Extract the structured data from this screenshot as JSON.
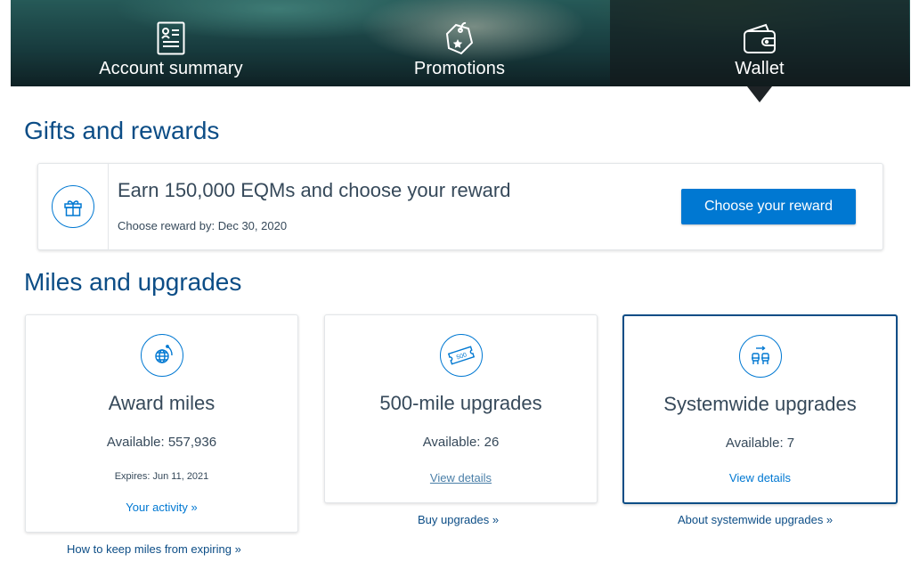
{
  "nav": {
    "tabs": [
      {
        "label": "Account summary",
        "icon": "account-summary-icon"
      },
      {
        "label": "Promotions",
        "icon": "promotion-tag-icon"
      },
      {
        "label": "Wallet",
        "icon": "wallet-icon",
        "active": true
      }
    ]
  },
  "gifts": {
    "title": "Gifts and rewards",
    "headline": "Earn 150,000 EQMs and choose your reward",
    "deadline": "Choose reward by: Dec 30, 2020",
    "button_label": "Choose your reward",
    "icon": "gift-icon"
  },
  "miles": {
    "title": "Miles and upgrades",
    "tiles": [
      {
        "icon": "globe-miles-icon",
        "title": "Award miles",
        "available": "Available: 557,936",
        "expires": "Expires: Jun 11, 2021",
        "link": "Your activity »",
        "below_link": "How to keep miles from expiring »"
      },
      {
        "icon": "ticket-500-icon",
        "title": "500-mile upgrades",
        "available": "Available: 26",
        "link": "View details",
        "below_link": "Buy upgrades »"
      },
      {
        "icon": "seat-upgrade-icon",
        "title": "Systemwide upgrades",
        "available": "Available: 7",
        "link": "View details",
        "below_link": "About systemwide upgrades »",
        "selected": true
      }
    ]
  },
  "colors": {
    "brand_blue": "#0078d2",
    "heading_blue": "#0c4d86",
    "text": "#36495a"
  }
}
